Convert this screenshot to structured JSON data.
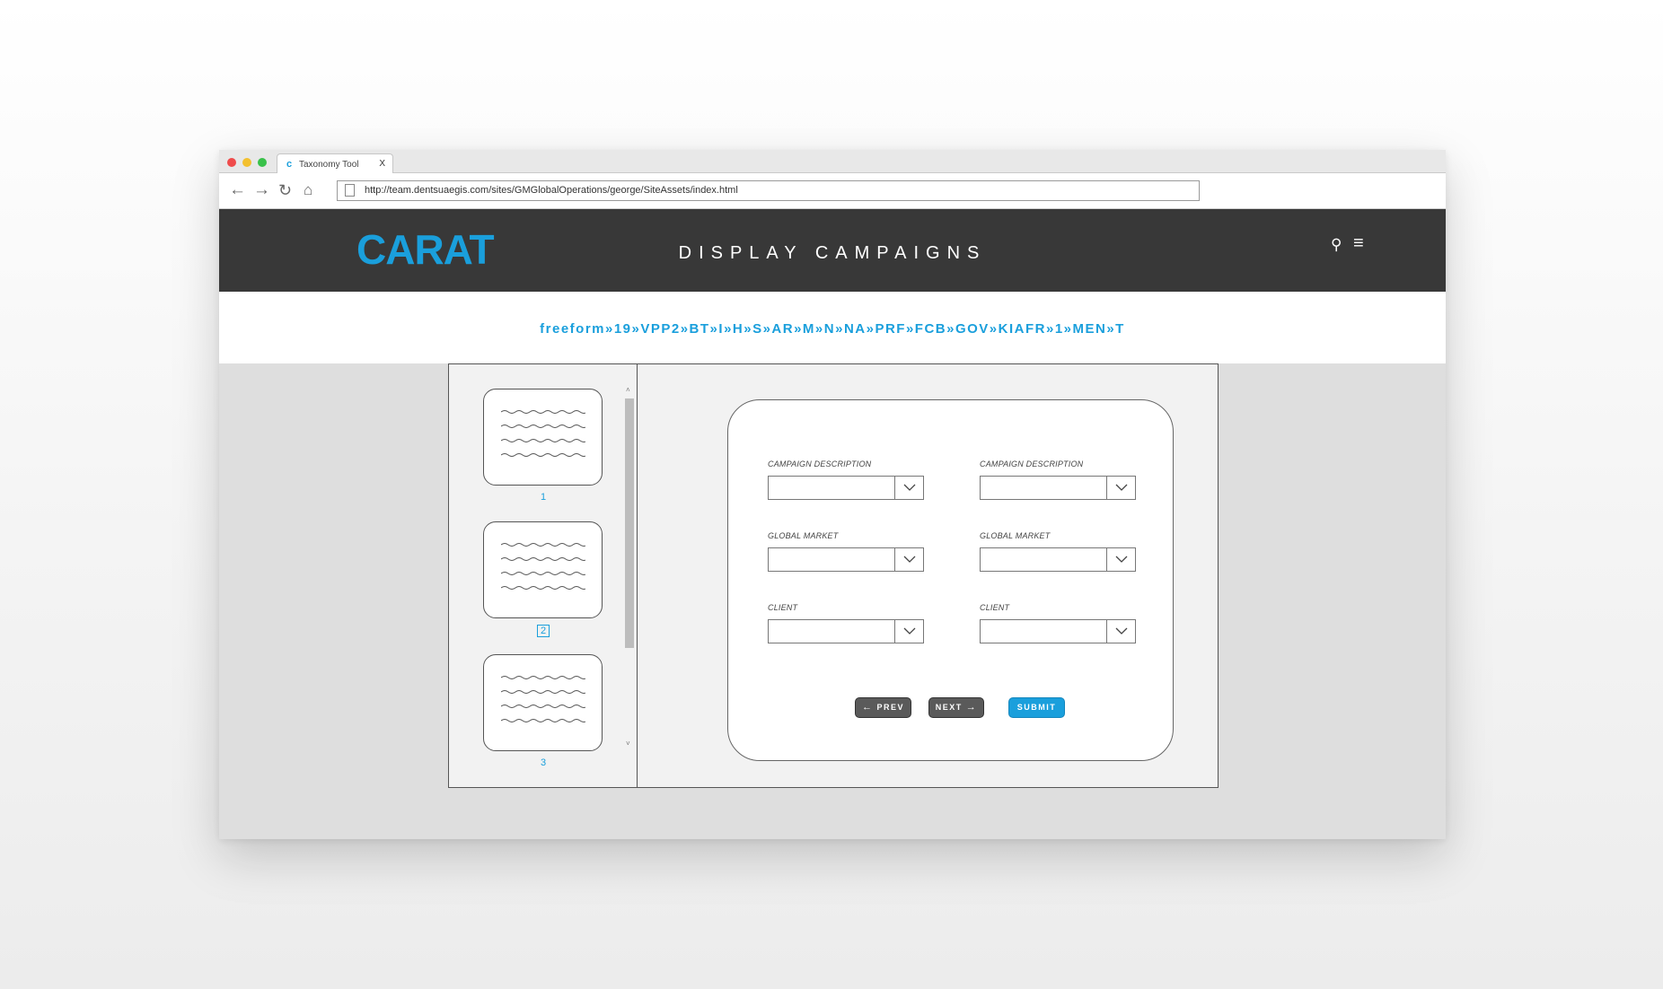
{
  "browser": {
    "tab_title": "Taxonomy Tool",
    "tab_close": "X",
    "tab_favicon": "c",
    "url": "http://team.dentsuaegis.com/sites/GMGlobalOperations/george/SiteAssets/index.html",
    "icons": {
      "back": "←",
      "forward": "→",
      "reload": "↻",
      "home": "⌂"
    }
  },
  "header": {
    "logo": "CARAT",
    "title": "DISPLAY CAMPAIGNS",
    "search_icon": "⚲",
    "menu_icon": "≡"
  },
  "taxonomy": "freeform»19»VPP2»BT»I»H»S»AR»M»N»NA»PRF»FCB»GOV»KIAFR»1»MEN»T",
  "sidebar": {
    "pages": [
      {
        "label": "1",
        "selected": false
      },
      {
        "label": "2",
        "selected": true
      },
      {
        "label": "3",
        "selected": false
      }
    ],
    "scroll_up": "˄",
    "scroll_down": "˅"
  },
  "form": {
    "left": [
      {
        "label": "CAMPAIGN DESCRIPTION",
        "value": ""
      },
      {
        "label": "GLOBAL MARKET",
        "value": ""
      },
      {
        "label": "CLIENT",
        "value": ""
      }
    ],
    "right": [
      {
        "label": "CAMPAIGN DESCRIPTION",
        "value": ""
      },
      {
        "label": "GLOBAL MARKET",
        "value": ""
      },
      {
        "label": "CLIENT",
        "value": ""
      }
    ],
    "buttons": {
      "prev": "PREV",
      "prev_icon": "←",
      "next": "NEXT",
      "next_icon": "→",
      "submit": "SUBMIT"
    }
  },
  "colors": {
    "accent": "#1a9fdc",
    "header_bg": "#383838",
    "button_dark": "#5a5a5a"
  }
}
